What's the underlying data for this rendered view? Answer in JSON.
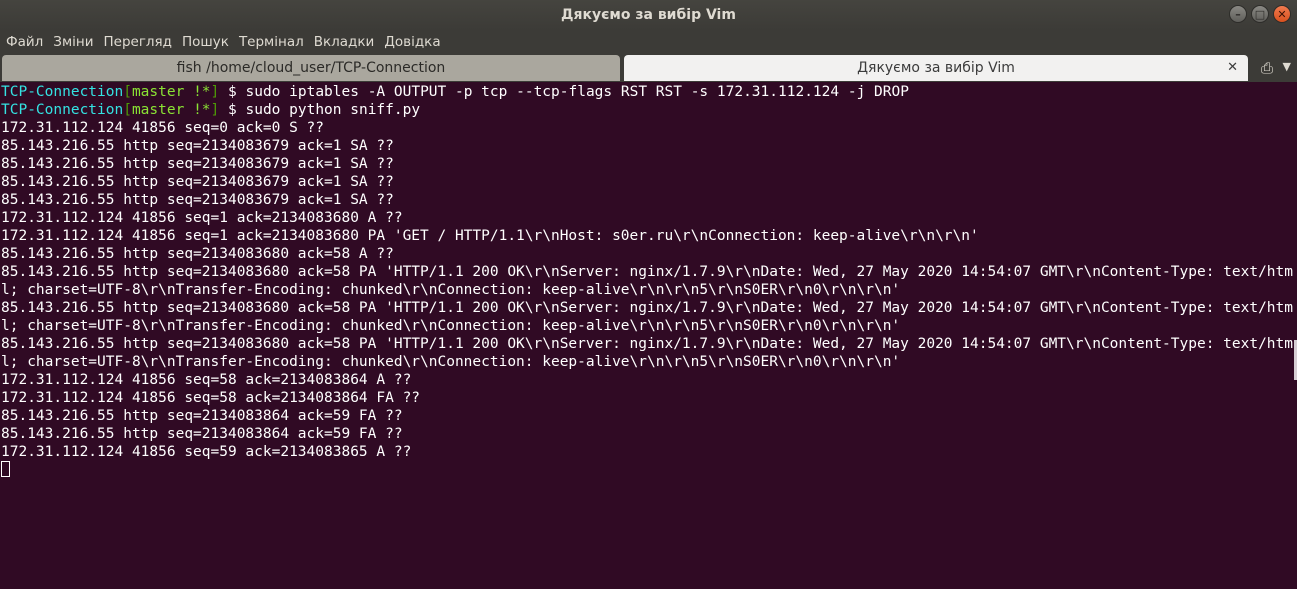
{
  "window": {
    "title": "Дякуємо за вибір Vim"
  },
  "menu": [
    "Файл",
    "Зміни",
    "Перегляд",
    "Пошук",
    "Термінал",
    "Вкладки",
    "Довідка"
  ],
  "tabs": [
    {
      "label": "fish  /home/cloud_user/TCP-Connection",
      "active": false
    },
    {
      "label": "Дякуємо за вибір Vim",
      "active": true
    }
  ],
  "prompt": {
    "dir": "TCP-Connection",
    "branch_open": "[",
    "branch": "master",
    "mark": " !*",
    "branch_close": "]",
    "symbol": " $ "
  },
  "commands": [
    "sudo iptables -A OUTPUT -p tcp --tcp-flags RST RST -s 172.31.112.124 -j DROP",
    "sudo python sniff.py"
  ],
  "output": [
    "172.31.112.124 41856 seq=0 ack=0 S ??",
    "85.143.216.55 http seq=2134083679 ack=1 SA ??",
    "85.143.216.55 http seq=2134083679 ack=1 SA ??",
    "85.143.216.55 http seq=2134083679 ack=1 SA ??",
    "85.143.216.55 http seq=2134083679 ack=1 SA ??",
    "172.31.112.124 41856 seq=1 ack=2134083680 A ??",
    "172.31.112.124 41856 seq=1 ack=2134083680 PA 'GET / HTTP/1.1\\r\\nHost: s0er.ru\\r\\nConnection: keep-alive\\r\\n\\r\\n'",
    "85.143.216.55 http seq=2134083680 ack=58 A ??",
    "85.143.216.55 http seq=2134083680 ack=58 PA 'HTTP/1.1 200 OK\\r\\nServer: nginx/1.7.9\\r\\nDate: Wed, 27 May 2020 14:54:07 GMT\\r\\nContent-Type: text/html; charset=UTF-8\\r\\nTransfer-Encoding: chunked\\r\\nConnection: keep-alive\\r\\n\\r\\n5\\r\\nS0ER\\r\\n0\\r\\n\\r\\n'",
    "85.143.216.55 http seq=2134083680 ack=58 PA 'HTTP/1.1 200 OK\\r\\nServer: nginx/1.7.9\\r\\nDate: Wed, 27 May 2020 14:54:07 GMT\\r\\nContent-Type: text/html; charset=UTF-8\\r\\nTransfer-Encoding: chunked\\r\\nConnection: keep-alive\\r\\n\\r\\n5\\r\\nS0ER\\r\\n0\\r\\n\\r\\n'",
    "85.143.216.55 http seq=2134083680 ack=58 PA 'HTTP/1.1 200 OK\\r\\nServer: nginx/1.7.9\\r\\nDate: Wed, 27 May 2020 14:54:07 GMT\\r\\nContent-Type: text/html; charset=UTF-8\\r\\nTransfer-Encoding: chunked\\r\\nConnection: keep-alive\\r\\n\\r\\n5\\r\\nS0ER\\r\\n0\\r\\n\\r\\n'",
    "172.31.112.124 41856 seq=58 ack=2134083864 A ??",
    "172.31.112.124 41856 seq=58 ack=2134083864 FA ??",
    "85.143.216.55 http seq=2134083864 ack=59 FA ??",
    "85.143.216.55 http seq=2134083864 ack=59 FA ??",
    "172.31.112.124 41856 seq=59 ack=2134083865 A ??"
  ],
  "icons": {
    "minimize": "minimize-icon",
    "maximize": "maximize-icon",
    "close": "close-icon",
    "new_tab": "new-tab-icon",
    "tab_menu": "chevron-down-icon"
  },
  "colors": {
    "terminal_bg": "#300a24",
    "prompt_dir": "#34e2e2",
    "prompt_branch": "#8ae234",
    "prompt_mark": "#4e9a06"
  }
}
